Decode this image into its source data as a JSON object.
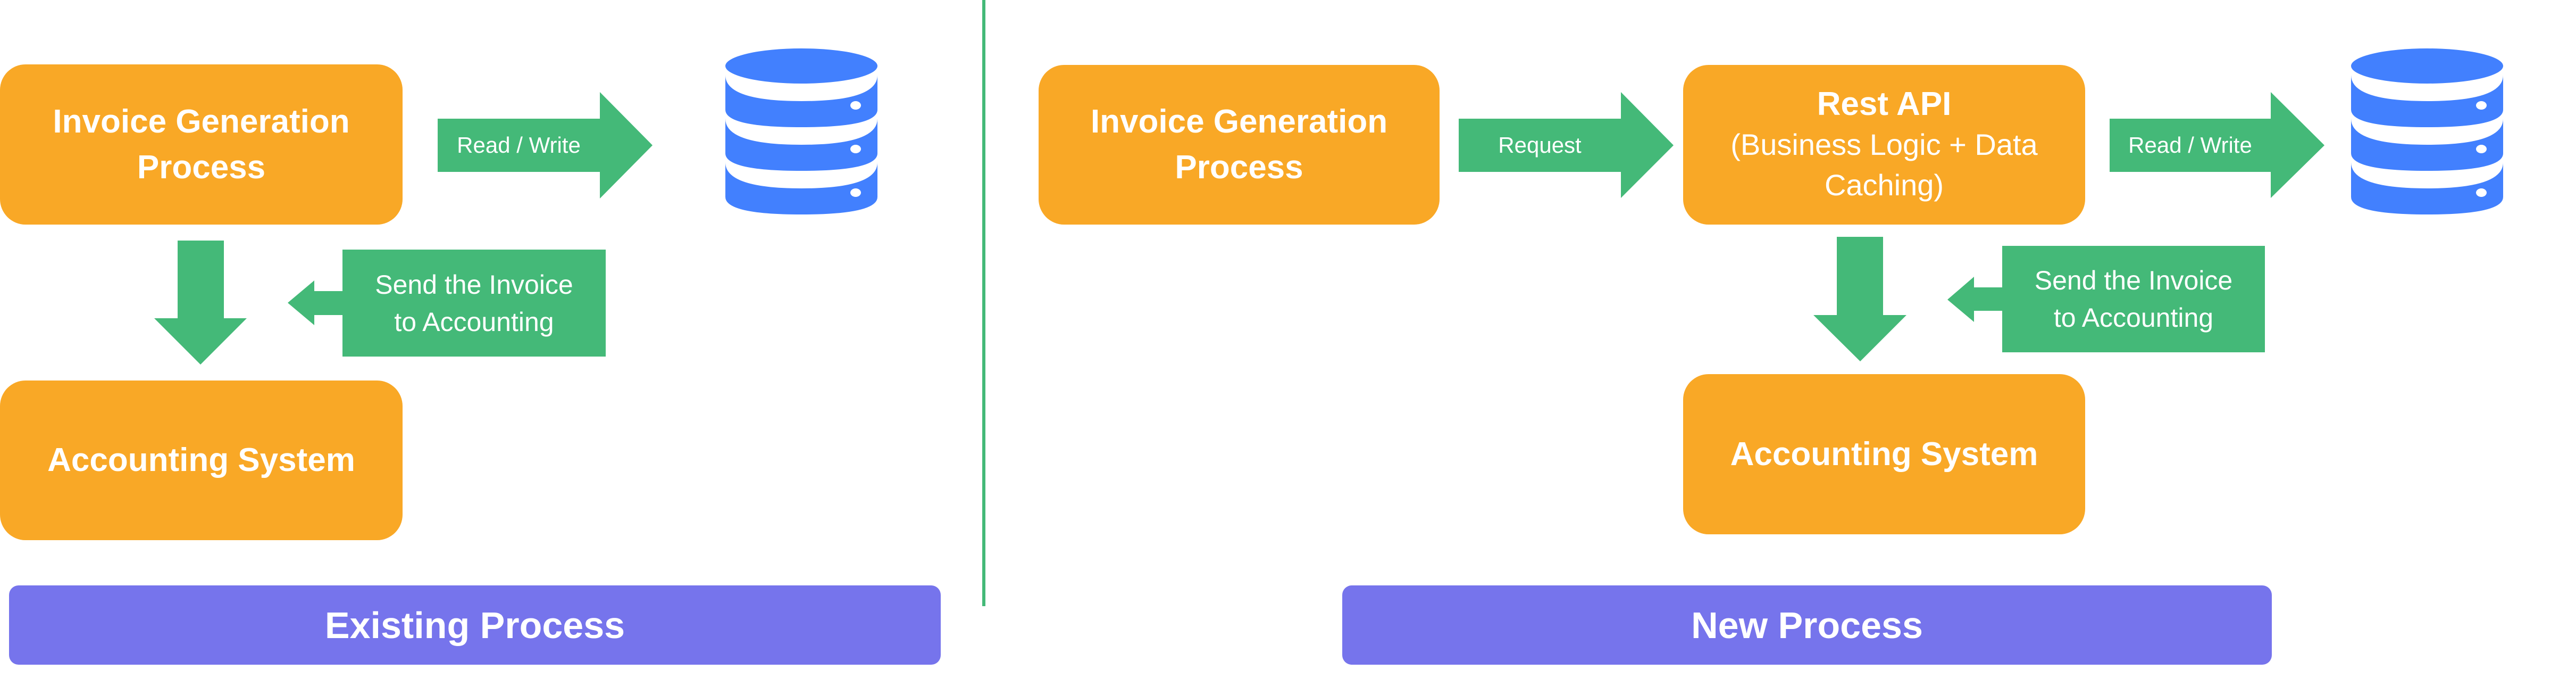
{
  "colors": {
    "process_box": "#f9a826",
    "arrow": "#44b978",
    "database": "#4280fe",
    "banner": "#7674ec",
    "divider": "#44b978",
    "text_on_shapes": "#ffffff"
  },
  "existing": {
    "banner": "Existing Process",
    "invoice_box": {
      "line1": "Invoice Generation",
      "line2": "Process"
    },
    "read_write_label": "Read / Write",
    "database_icon": "database-icon",
    "send_label": {
      "line1": "Send the Invoice",
      "line2": "to Accounting"
    },
    "accounting_box": "Accounting System"
  },
  "new": {
    "banner": "New Process",
    "invoice_box": {
      "line1": "Invoice Generation",
      "line2": "Process"
    },
    "request_label": "Request",
    "rest_api_box": {
      "title": "Rest API",
      "line1": "(Business Logic + Data",
      "line2": "Caching)"
    },
    "read_write_label": "Read / Write",
    "database_icon": "database-icon",
    "send_label": {
      "line1": "Send the Invoice",
      "line2": "to Accounting"
    },
    "accounting_box": "Accounting System"
  }
}
